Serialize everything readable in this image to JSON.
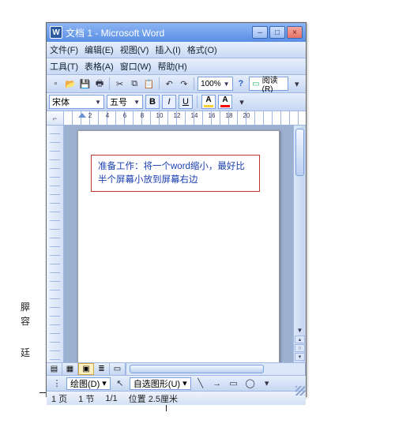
{
  "window": {
    "icon_letter": "W",
    "title": "文档 1 - Microsoft Word",
    "min": "–",
    "max": "□",
    "close": "×"
  },
  "menus": {
    "row1": [
      "文件(F)",
      "编辑(E)",
      "视图(V)",
      "插入(I)",
      "格式(O)"
    ],
    "row2": [
      "工具(T)",
      "表格(A)",
      "窗口(W)",
      "帮助(H)"
    ]
  },
  "toolbar": {
    "zoom": "100%",
    "read_label": "阅读(R)"
  },
  "format": {
    "font": "宋体",
    "size": "五号",
    "bold": "B",
    "italic": "I",
    "underline": "U",
    "highlight_color": "#ffcc33",
    "font_color": "#ff0000"
  },
  "ruler": {
    "corner": "⌐",
    "numbers": [
      "",
      "2",
      "4",
      "6",
      "8",
      "10",
      "12",
      "14",
      "16",
      "18",
      "20"
    ]
  },
  "document": {
    "textbox": "准备工作：将一个word缩小，最好比半个屏幕小放到屏幕右边"
  },
  "drawbar": {
    "draw_label": "绘图(D)",
    "autoshapes": "自选图形(U)"
  },
  "status": {
    "page": "1 页",
    "section": "1 节",
    "pages": "1/1",
    "position": "位置 2.5厘米"
  },
  "bg": {
    "t1": "臎",
    "t2": "容",
    "t3": "廷"
  }
}
